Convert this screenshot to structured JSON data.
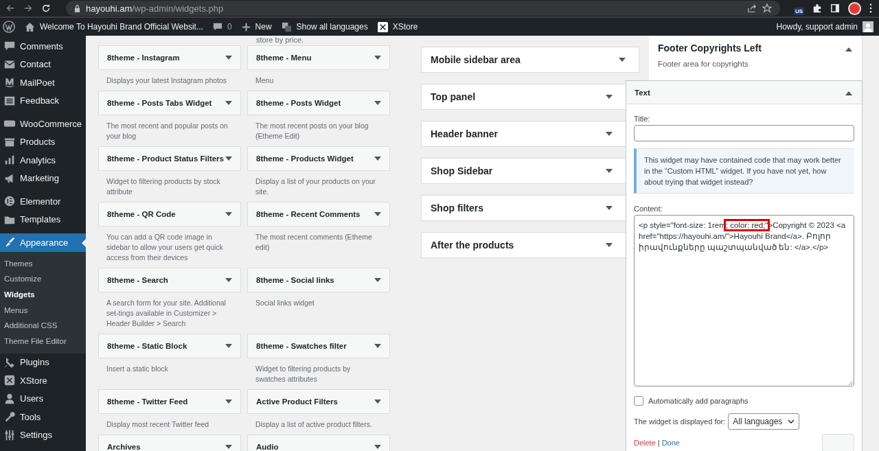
{
  "browser": {
    "url_host": "hayouhi.am",
    "url_path": "/wp-admin/widgets.php",
    "extension_badge": "US"
  },
  "admin_bar": {
    "site_title": "Welcome To Hayouhi Brand Official Websit...",
    "comments_count": "0",
    "new_label": "New",
    "languages_label": "Show all languages",
    "theme_label": "XStore",
    "greeting": "Howdy, support admin"
  },
  "sidebar": {
    "groups": [
      {
        "items": [
          {
            "label": "Comments",
            "selected": false
          },
          {
            "label": "Contact",
            "selected": false
          },
          {
            "label": "MailPoet",
            "selected": false
          },
          {
            "label": "Feedback",
            "selected": false
          }
        ]
      },
      {
        "items": [
          {
            "label": "WooCommerce",
            "selected": false
          },
          {
            "label": "Products",
            "selected": false
          },
          {
            "label": "Analytics",
            "selected": false
          },
          {
            "label": "Marketing",
            "selected": false
          }
        ]
      },
      {
        "items": [
          {
            "label": "Elementor",
            "selected": false
          },
          {
            "label": "Templates",
            "selected": false
          }
        ]
      },
      {
        "items": [
          {
            "label": "Appearance",
            "selected": true,
            "children": [
              {
                "label": "Themes",
                "selected": false
              },
              {
                "label": "Customize",
                "selected": false
              },
              {
                "label": "Widgets",
                "selected": true
              },
              {
                "label": "Menus",
                "selected": false
              },
              {
                "label": "Additional CSS",
                "selected": false
              },
              {
                "label": "Theme File Editor",
                "selected": false
              }
            ]
          },
          {
            "label": "Plugins",
            "selected": false
          },
          {
            "label": "XStore",
            "selected": false
          },
          {
            "label": "Users",
            "selected": false
          },
          {
            "label": "Tools",
            "selected": false
          },
          {
            "label": "Settings",
            "selected": false
          }
        ]
      }
    ]
  },
  "available_widgets": {
    "cut_text": "store by price.",
    "items": [
      {
        "title": "8theme - Instagram",
        "description": "Displays your latest Instagram photos"
      },
      {
        "title": "8theme - Menu",
        "description": "Menu"
      },
      {
        "title": "8theme - Posts Tabs Widget",
        "description": "The most recent and popular posts on your blog"
      },
      {
        "title": "8theme - Posts Widget",
        "description": "The most recent posts on your blog (Etheme Edit)"
      },
      {
        "title": "8theme - Product Status Filters",
        "description": "Widget to filtering products by stock attribute"
      },
      {
        "title": "8theme - Products Widget",
        "description": "Display a list of your products on your site."
      },
      {
        "title": "8theme - QR Code",
        "description": "You can add a QR code image in sidebar to allow your users get quick access from their devices"
      },
      {
        "title": "8theme - Recent Comments",
        "description": "The most recent comments (Etheme edit)"
      },
      {
        "title": "8theme - Search",
        "description": "A search form for your site. Additional set-tings available in Customizer > Header Builder > Search"
      },
      {
        "title": "8theme - Social links",
        "description": "Social links widget"
      },
      {
        "title": "8theme - Static Block",
        "description": "Insert a static block"
      },
      {
        "title": "8theme - Swatches filter",
        "description": "Widget to filtering products by swatches attributes"
      },
      {
        "title": "8theme - Twitter Feed",
        "description": "Display most recent Twitter feed"
      },
      {
        "title": "Active Product Filters",
        "description": "Display a list of active product filters."
      },
      {
        "title": "Archives"
      },
      {
        "title": "Audio"
      }
    ]
  },
  "widget_areas": [
    {
      "title": "Mobile sidebar area",
      "expanded": false
    },
    {
      "title": "Top panel",
      "expanded": false
    },
    {
      "title": "Header banner",
      "expanded": false
    },
    {
      "title": "Shop Sidebar",
      "expanded": false
    },
    {
      "title": "Shop filters",
      "expanded": false
    },
    {
      "title": "After the products",
      "expanded": false
    }
  ],
  "footer_area": {
    "title": "Footer Copyrights Left",
    "description": "Footer area for copyrights",
    "expanded": true
  },
  "text_widget": {
    "title": "Text",
    "expanded": true,
    "title_label": "Title:",
    "notice": "This widget may have contained code that may work better in the “Custom HTML” widget. If you have not yet, how about trying that widget instead?",
    "content_label": "Content:",
    "content_parts": [
      {
        "text": "<p style=\"font-size: 1rem",
        "highlighted": false
      },
      {
        "text": "; color: red;\"",
        "highlighted": true
      },
      {
        "text": ">Copyright © 2023 <a href=\"https://hayouhi.am/\">Hayouhi Brand</a>. Բոլոր իրավունքները պաշտպանված են: </a>.</p>",
        "highlighted": false
      }
    ],
    "auto_paragraphs": {
      "label": "Automatically add paragraphs",
      "checked": false
    },
    "display_label": "The widget is displayed for:",
    "display_value": "All languages",
    "delete_label": "Delete",
    "action_separator": "|",
    "done_label": "Done"
  }
}
